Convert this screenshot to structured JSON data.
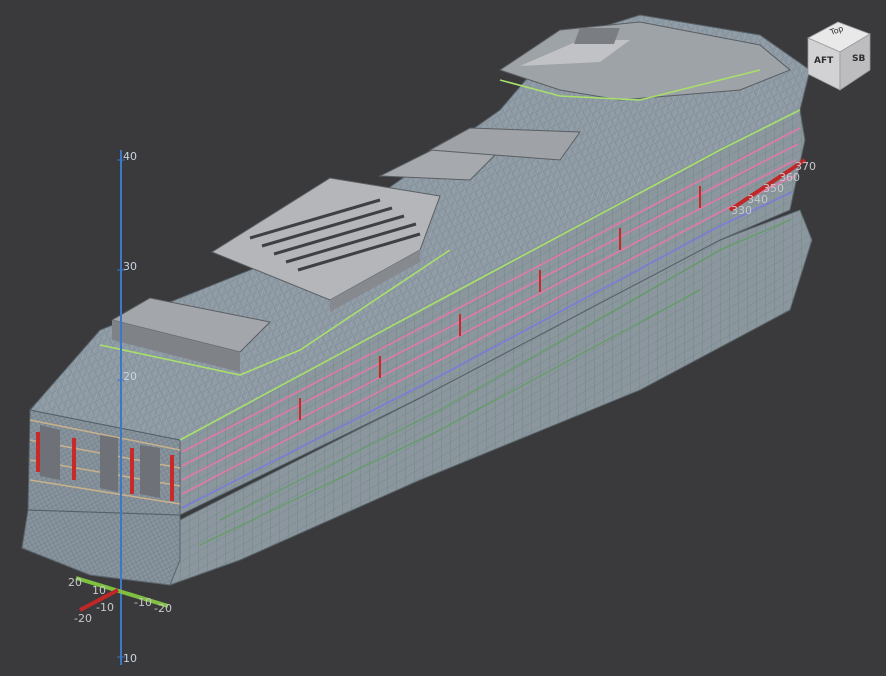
{
  "view_cube": {
    "top_label": "Top",
    "aft_label": "AFT",
    "sb_label": "SB"
  },
  "vertical_axis": {
    "labels": [
      "40",
      "30",
      "20",
      "10"
    ],
    "color": "#3a78c8"
  },
  "longitudinal_axis": {
    "labels": [
      "370",
      "360",
      "350",
      "340",
      "330"
    ],
    "color": "#c02828"
  },
  "origin_axes": {
    "green_labels": [
      "20",
      "10",
      "-10",
      "-20"
    ],
    "red_labels": [
      "-10",
      "-20"
    ],
    "green_color": "#7fc040",
    "red_color": "#c02828"
  },
  "colors": {
    "background": "#3a3a3c",
    "hull": "#8a96a0",
    "deck_plate": "#b0b2b6",
    "highlight_green": "#a8e06c",
    "highlight_pink": "#e07aa8",
    "highlight_blue": "#7a7cd8",
    "window_red": "#c82a2a"
  }
}
